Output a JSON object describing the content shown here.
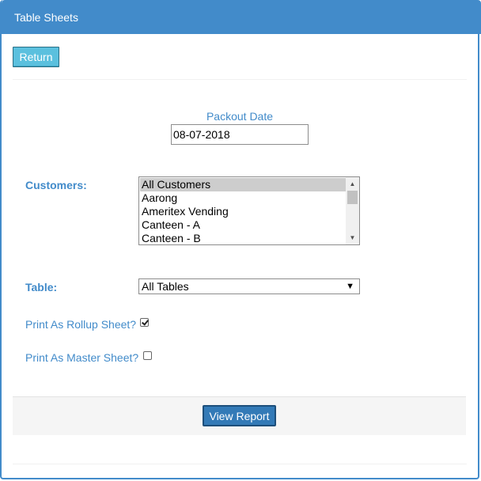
{
  "panel": {
    "title": "Table Sheets"
  },
  "toolbar": {
    "return_label": "Return"
  },
  "packout": {
    "label": "Packout Date",
    "value": "08-07-2018"
  },
  "customers": {
    "label": "Customers:",
    "items": [
      "All Customers",
      "Aarong",
      "Ameritex Vending",
      "Canteen - A",
      "Canteen - B"
    ],
    "selected": "All Customers"
  },
  "table": {
    "label": "Table:",
    "selected": "All Tables"
  },
  "options": {
    "rollup_label": "Print As Rollup Sheet?",
    "rollup_checked": true,
    "master_label": "Print As Master Sheet?",
    "master_checked": false
  },
  "actions": {
    "view_report_label": "View Report"
  },
  "colors": {
    "header_bg": "#428bca",
    "accent_text": "#428bca",
    "primary_button": "#337ab7",
    "info_button": "#5bc0de"
  }
}
